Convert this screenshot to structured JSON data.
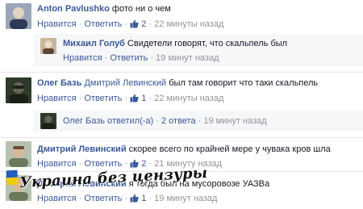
{
  "comments": [
    {
      "author": "Anton Pavlushko",
      "text": "фото ни о чем",
      "like": "Нравится",
      "reply": "Ответить",
      "likes": "2",
      "time": "22 минуты назад"
    },
    {
      "author": "Михаил Голуб",
      "text": "Свидетели говорят, что скальпель был",
      "like": "Нравится",
      "reply": "Ответить",
      "time": "19 минут назад"
    },
    {
      "author": "Олег Базь",
      "mention": "Дмитрий Левинский",
      "text": "был там говорит что таки скальпель",
      "like": "Нравится",
      "reply": "Ответить",
      "likes": "1",
      "time": "22 минуты назад"
    },
    {
      "author": "Олег Базь",
      "replied": "ответил(-а)",
      "count": "2 ответа",
      "time": "19 минут назад"
    },
    {
      "author": "Дмитрий Левинский",
      "text": "скорее всего по крайней мере у чувака кров шла",
      "like": "Нравится",
      "reply": "Ответить",
      "likes": "2",
      "time": "21 минуту назад"
    },
    {
      "author": "Дмитрий Левинский",
      "text": "я тогда был на мусоровозе УАЗВа",
      "like": "Нравится",
      "reply": "Ответить",
      "likes": "1",
      "time": "19 минут назад"
    }
  ],
  "separator": "·",
  "watermark": "Украина без цензуры",
  "colors": {
    "link": "#3b5998",
    "meta": "#90949c",
    "shade": "#f6f7f9"
  }
}
